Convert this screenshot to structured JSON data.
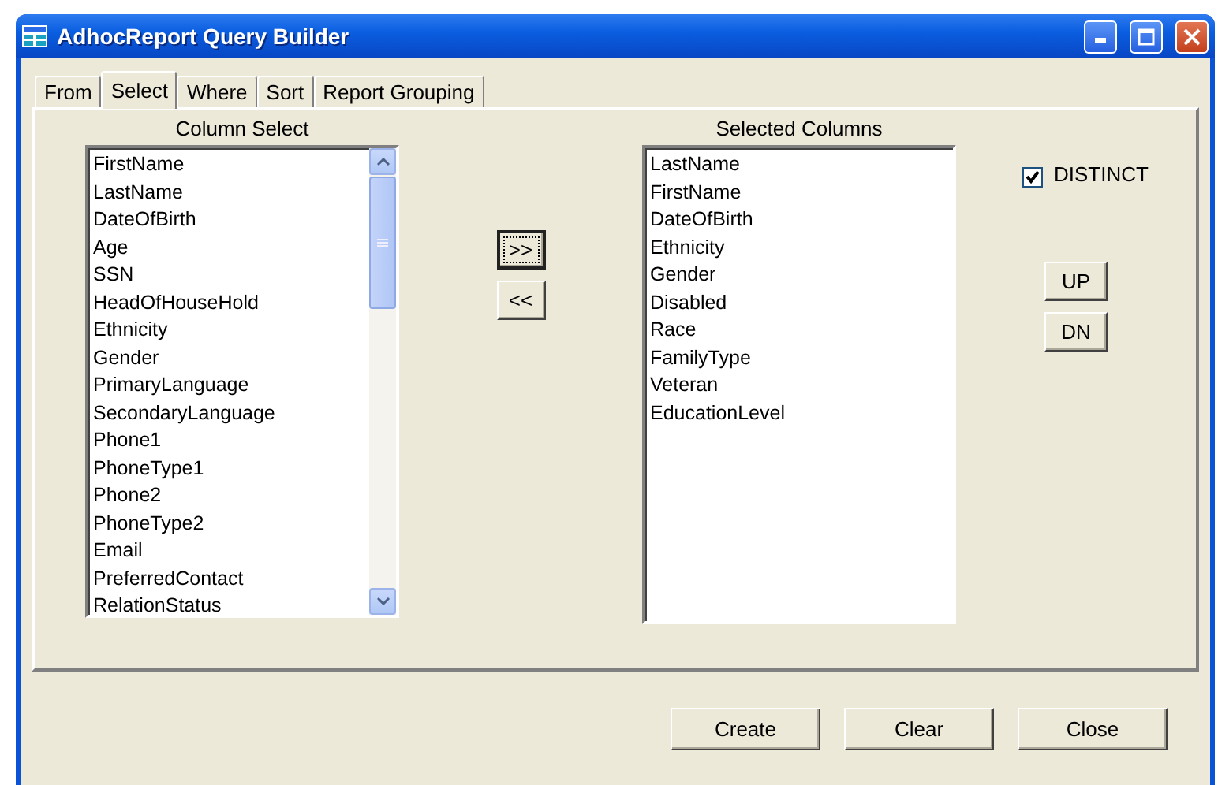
{
  "window": {
    "title": "AdhocReport Query Builder"
  },
  "tabs": [
    {
      "label": "From",
      "selected": false
    },
    {
      "label": "Select",
      "selected": true
    },
    {
      "label": "Where",
      "selected": false
    },
    {
      "label": "Sort",
      "selected": false
    },
    {
      "label": "Report Grouping",
      "selected": false
    }
  ],
  "column_select": {
    "label": "Column Select",
    "items": [
      "FirstName",
      "LastName",
      "DateOfBirth",
      "Age",
      "SSN",
      "HeadOfHouseHold",
      "Ethnicity",
      "Gender",
      "PrimaryLanguage",
      "SecondaryLanguage",
      "Phone1",
      "PhoneType1",
      "Phone2",
      "PhoneType2",
      "Email",
      "PreferredContact",
      "RelationStatus"
    ]
  },
  "move_buttons": [
    {
      "label": ">>",
      "focused": true
    },
    {
      "label": "<<",
      "focused": false
    }
  ],
  "selected_columns": {
    "label": "Selected Columns",
    "items": [
      "LastName",
      "FirstName",
      "DateOfBirth",
      "Ethnicity",
      "Gender",
      "Disabled",
      "Race",
      "FamilyType",
      "Veteran",
      "EducationLevel"
    ]
  },
  "distinct": {
    "label": "DISTINCT",
    "checked": true
  },
  "order_buttons": [
    "UP",
    "DN"
  ],
  "buttons": [
    "Create",
    "Clear",
    "Close"
  ]
}
